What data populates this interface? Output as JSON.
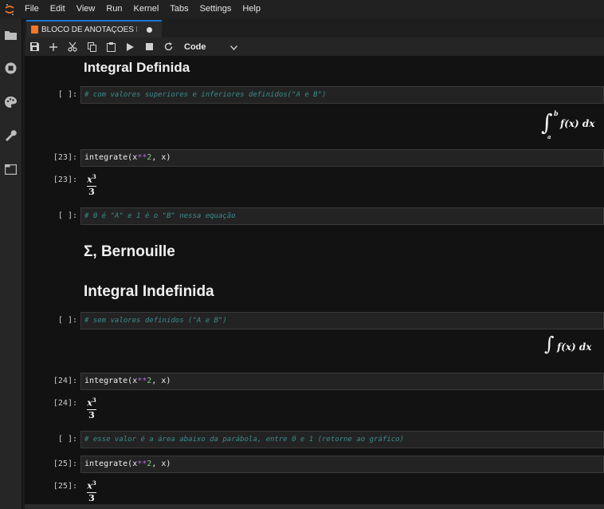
{
  "menu": [
    "File",
    "Edit",
    "View",
    "Run",
    "Kernel",
    "Tabs",
    "Settings",
    "Help"
  ],
  "tab": {
    "title": "BLOCO DE ANOTAÇOES Mo"
  },
  "toolbar": {
    "cell_type": "Code"
  },
  "cells": {
    "h1": "Integral Definida",
    "c1": {
      "prompt": "[ ]:",
      "code": "# com valores superiores e inferiores definidos(\"A e B\")"
    },
    "m1": {
      "integrand": "f(x) dx",
      "upper": "b",
      "lower": "a"
    },
    "c2": {
      "prompt": "[23]:",
      "code_fn": "integrate(",
      "code_x": "x",
      "code_op": "**",
      "code_num": "2",
      "code_rest": ", x)"
    },
    "o2": {
      "prompt": "[23]:",
      "num": "x",
      "exp": "3",
      "den": "3"
    },
    "c3": {
      "prompt": "[ ]:",
      "code": "# 0 é \"A\" e 1 é o \"B\" nessa equação"
    },
    "h2": "Σ, Bernouille",
    "h3": "Integral Indefinida",
    "c4": {
      "prompt": "[ ]:",
      "code": "# sem valores definidos (\"A e B\")"
    },
    "m2": {
      "integrand": "f(x) dx"
    },
    "c5": {
      "prompt": "[24]:",
      "code_fn": "integrate(",
      "code_x": "x",
      "code_op": "**",
      "code_num": "2",
      "code_rest": ", x)"
    },
    "o5": {
      "prompt": "[24]:",
      "num": "x",
      "exp": "3",
      "den": "3"
    },
    "c6": {
      "prompt": "[ ]:",
      "code": "# esse valor é a área abaixo da parábola, entre 0 e 1 (retorne ao gráfico)"
    },
    "c7": {
      "prompt": "[25]:",
      "code_fn": "integrate(",
      "code_x": "x",
      "code_op": "**",
      "code_num": "2",
      "code_rest": ", x)"
    },
    "o7": {
      "prompt": "[25]:",
      "num": "x",
      "exp": "3",
      "den": "3"
    }
  }
}
